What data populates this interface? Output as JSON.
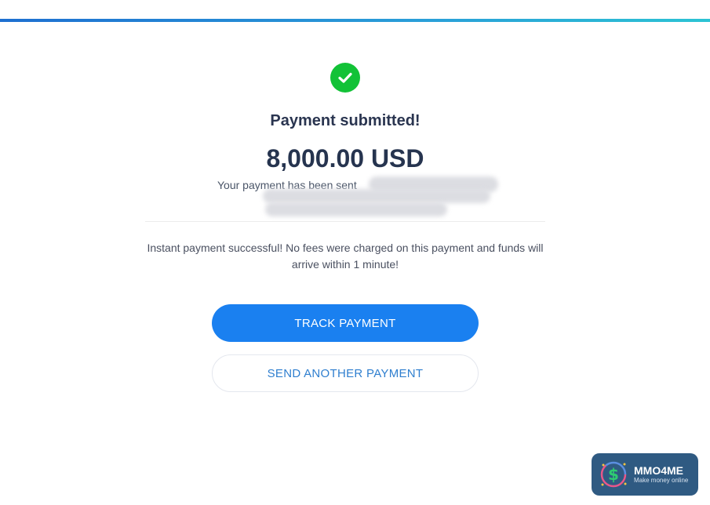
{
  "icons": {
    "status": "check-circle-icon",
    "logo": "dollar-coin-icon"
  },
  "colors": {
    "accent_bar": "#1e6fd0",
    "success": "#12c237",
    "primary_button": "#1a80f0",
    "heading": "#2a3550",
    "link_blue": "#2f7fcf",
    "logo_bg": "#2f5a82"
  },
  "confirmation": {
    "title": "Payment submitted!",
    "amount": "8,000.00 USD",
    "sent_message": "Your payment has been sent"
  },
  "info": {
    "message": "Instant payment successful! No fees were charged on this payment and funds will arrive within 1 minute!"
  },
  "buttons": {
    "track": "TRACK PAYMENT",
    "send_another": "SEND ANOTHER PAYMENT"
  },
  "watermark": {
    "name": "MMO4ME",
    "tagline": "Make money online"
  }
}
